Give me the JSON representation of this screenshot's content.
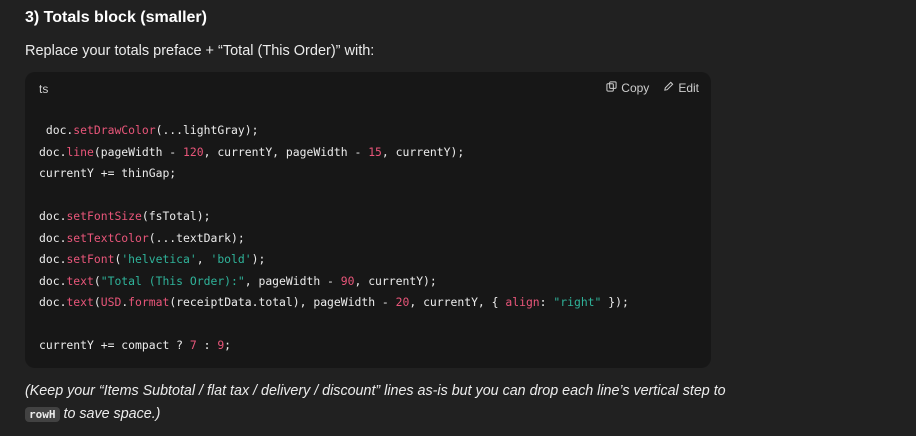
{
  "heading": "3) Totals block (smaller)",
  "intro": "Replace your totals preface + “Total (This Order)” with:",
  "code_block": {
    "language": "ts",
    "copy_label": "Copy",
    "edit_label": "Edit",
    "lines": [
      " doc.setDrawColor(...lightGray);",
      "doc.line(pageWidth - 120, currentY, pageWidth - 15, currentY);",
      "currentY += thinGap;",
      "",
      "doc.setFontSize(fsTotal);",
      "doc.setTextColor(...textDark);",
      "doc.setFont('helvetica', 'bold');",
      "doc.text(\"Total (This Order):\", pageWidth - 90, currentY);",
      "doc.text(USD.format(receiptData.total), pageWidth - 20, currentY, { align: \"right\" });",
      "",
      "currentY += compact ? 7 : 9;"
    ]
  },
  "note": {
    "before": "(Keep your “Items Subtotal / flat tax / delivery / discount” lines as-is but you can drop each line’s vertical step to",
    "code": "rowH",
    "after": " to save space.)"
  },
  "colors": {
    "background": "#212121",
    "code_background": "#171717",
    "method": "#e9567a",
    "string": "#2fb39a"
  }
}
